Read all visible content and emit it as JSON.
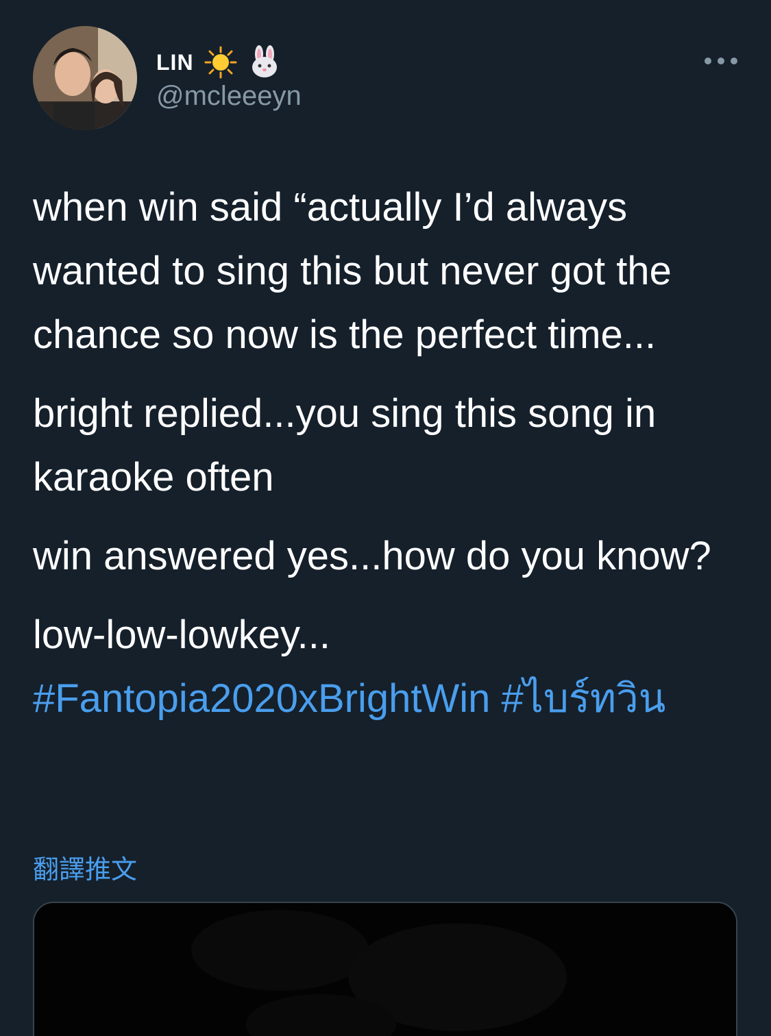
{
  "tweet": {
    "author": {
      "display_name": "LIN",
      "handle": "@mcleeeyn",
      "name_emojis": [
        "sun-emoji",
        "rabbit-face-emoji"
      ]
    },
    "paragraphs": [
      "when win said “actually I’d always wanted to sing this but never got the chance so now is the perfect time...",
      "bright replied...you sing this song in karaoke often",
      "win answered yes...how do you know?",
      "low-low-lowkey..."
    ],
    "hashtags": [
      "#Fantopia2020xBrightWin",
      "#ไบร์ทวิน"
    ],
    "translate_label": "翻譯推文"
  },
  "colors": {
    "background": "#15202b",
    "text": "#ffffff",
    "secondary_text": "#8899a6",
    "link": "#4a9eed",
    "card_border": "#38444d"
  }
}
